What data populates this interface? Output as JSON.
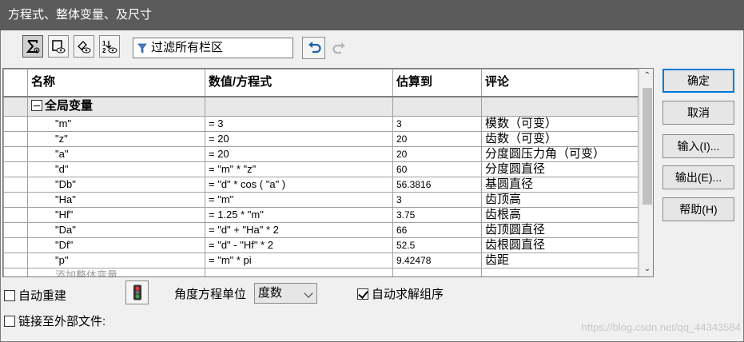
{
  "window": {
    "title": "方程式、整体变量、及尺寸"
  },
  "toolbar": {
    "filter_text": "过滤所有栏区",
    "buttons": [
      "sigma-equations-view",
      "sketch-equations-view",
      "dimension-view",
      "ordered-view"
    ]
  },
  "grid": {
    "headers": {
      "name": "名称",
      "value": "数值/方程式",
      "estimate": "估算到",
      "comment": "评论"
    },
    "group_label": "全局变量",
    "rows": [
      {
        "name": "\"m\"",
        "value": "= 3",
        "estimate": "3",
        "comment": "模数（可变）"
      },
      {
        "name": "\"z\"",
        "value": "= 20",
        "estimate": "20",
        "comment": "齿数（可变）"
      },
      {
        "name": "\"a\"",
        "value": "= 20",
        "estimate": "20",
        "comment": "分度圆压力角（可变）"
      },
      {
        "name": "\"d\"",
        "value": "= \"m\" * \"z\"",
        "estimate": "60",
        "comment": "分度圆直径"
      },
      {
        "name": "\"Db\"",
        "value": "= \"d\" * cos ( \"a\" )",
        "estimate": "56.3816",
        "comment": "基圆直径"
      },
      {
        "name": "\"Ha\"",
        "value": "= \"m\"",
        "estimate": "3",
        "comment": "齿顶高"
      },
      {
        "name": "\"Hf\"",
        "value": "= 1.25 * \"m\"",
        "estimate": "3.75",
        "comment": "齿根高"
      },
      {
        "name": "\"Da\"",
        "value": "= \"d\" + \"Ha\" * 2",
        "estimate": "66",
        "comment": "齿顶圆直径"
      },
      {
        "name": "\"Df\"",
        "value": "= \"d\" - \"Hf\" * 2",
        "estimate": "52.5",
        "comment": "齿根圆直径"
      },
      {
        "name": "\"p\"",
        "value": "= \"m\" * pi",
        "estimate": "9.42478",
        "comment": "齿距"
      }
    ],
    "add_row_label": "添加整体变量"
  },
  "side_buttons": {
    "ok": "确定",
    "cancel": "取消",
    "import": "输入(I)...",
    "export": "输出(E)...",
    "help": "帮助(H)"
  },
  "bottom": {
    "auto_rebuild": {
      "label": "自动重建",
      "checked": false
    },
    "angle_unit_label": "角度方程单位",
    "angle_unit_value": "度数",
    "auto_solve": {
      "label": "自动求解组序",
      "checked": true
    },
    "link_external": {
      "label": "链接至外部文件:",
      "checked": false
    }
  },
  "watermark": "https://blog.csdn.net/qq_44343584",
  "colors": {
    "titlebar": "#5b5b5b",
    "primary_border": "#0078d7"
  }
}
